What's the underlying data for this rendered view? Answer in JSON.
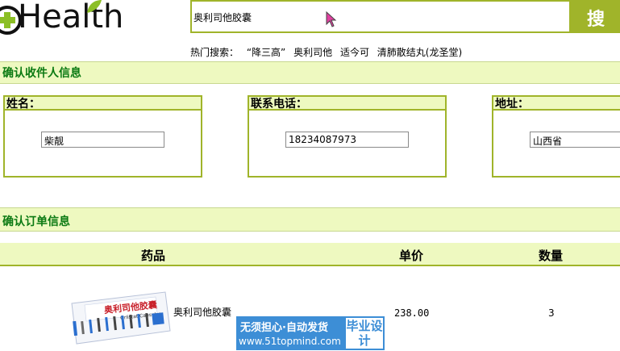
{
  "header": {
    "logo_text": "Health",
    "search_value": "奥利司他胶囊",
    "search_button": "搜 索"
  },
  "hot": {
    "label": "热门搜索：",
    "items": [
      "“降三高”",
      "奥利司他",
      "适今可",
      "清肺散结丸(龙圣堂)"
    ]
  },
  "receiver": {
    "title": "确认收件人信息",
    "name_label": "姓名：",
    "name_value": "柴靓",
    "phone_label": "联系电话：",
    "phone_value": "18234087973",
    "address_label": "地址：",
    "address_value": "山西省"
  },
  "order": {
    "title": "确认订单信息",
    "columns": [
      "药品",
      "单价",
      "数量"
    ],
    "rows": [
      {
        "name": "奥利司他胶囊",
        "price": "238.00",
        "qty": "3",
        "image_icon": "medicine-box-icon"
      }
    ]
  },
  "watermark": {
    "line1": "无须担心·自动发货",
    "line2": "www.51topmind.com",
    "badge": "毕业设计"
  },
  "colors": {
    "accent": "#a0b42a",
    "section_bg": "#eef9c0",
    "title_green": "#0b7a12",
    "watermark_blue": "#3d8ed6"
  }
}
